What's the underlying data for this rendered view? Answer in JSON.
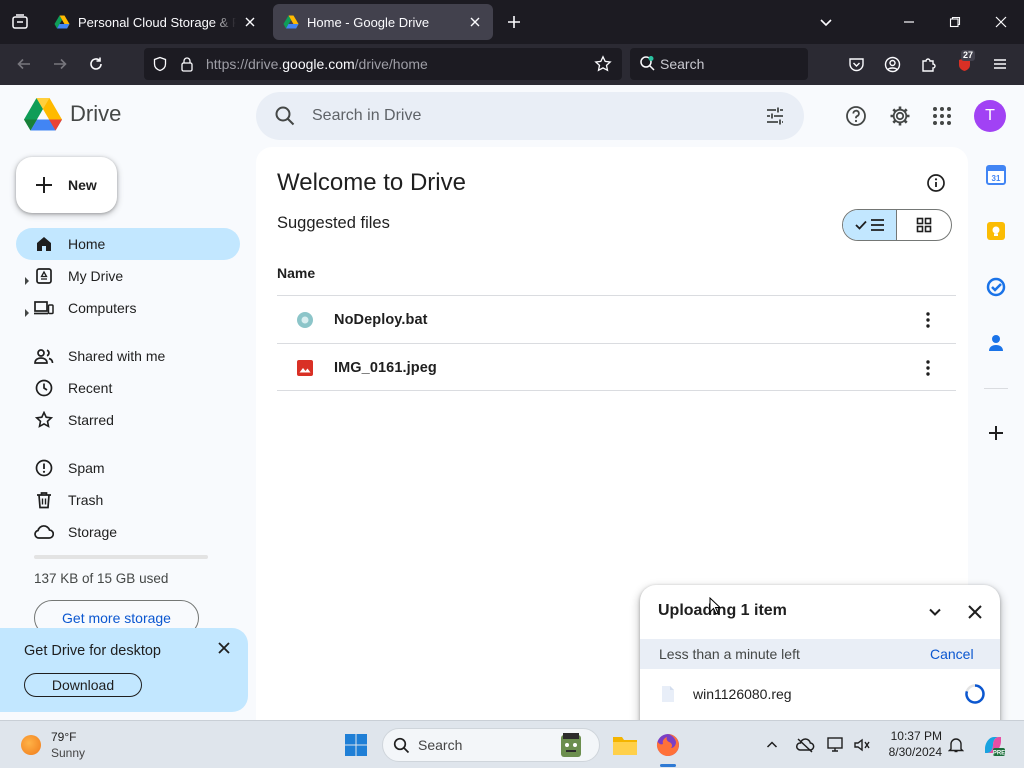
{
  "browser": {
    "tabs": [
      {
        "title": "Personal Cloud Storage & File Sharing"
      },
      {
        "title": "Home - Google Drive"
      }
    ],
    "url": {
      "prefix": "https://drive.",
      "domain": "google.com",
      "path": "/drive/home"
    },
    "search_placeholder": "Search",
    "extension_badge": "27"
  },
  "drive": {
    "logo_text": "Drive",
    "search_placeholder": "Search in Drive",
    "avatar_initial": "T",
    "new_label": "New",
    "nav": [
      {
        "label": "Home"
      },
      {
        "label": "My Drive"
      },
      {
        "label": "Computers"
      },
      {
        "label": "Shared with me"
      },
      {
        "label": "Recent"
      },
      {
        "label": "Starred"
      },
      {
        "label": "Spam"
      },
      {
        "label": "Trash"
      },
      {
        "label": "Storage"
      }
    ],
    "storage": {
      "used_text": "137 KB of 15 GB used",
      "used_fraction": 0.0,
      "button": "Get more storage"
    },
    "promo": {
      "title": "Get Drive for desktop",
      "button": "Download"
    },
    "main": {
      "title": "Welcome to Drive",
      "subtitle": "Suggested files",
      "column_name": "Name",
      "files": [
        {
          "name": "NoDeploy.bat",
          "icon": "generic-file-icon"
        },
        {
          "name": "IMG_0161.jpeg",
          "icon": "image-file-icon"
        }
      ]
    },
    "upload": {
      "title": "Uploading 1 item",
      "status": "Less than a minute left",
      "cancel": "Cancel",
      "file": "win1126080.reg"
    }
  },
  "taskbar": {
    "weather_temp": "79°F",
    "weather_cond": "Sunny",
    "search_label": "Search",
    "time": "10:37 PM",
    "date": "8/30/2024"
  },
  "colors": {
    "accent": "#0b57d0",
    "active_nav": "#c2e7ff",
    "avatar": "#a142f4"
  }
}
